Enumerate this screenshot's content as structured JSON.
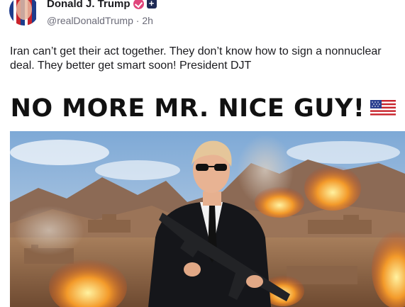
{
  "post": {
    "display_name": "Donald J. Trump",
    "handle": "@realDonaldTrump",
    "separator": "·",
    "timestamp": "2h",
    "text": "Iran can’t get their act together. They don’t know how to sign a nonnuclear deal. They better get smart soon! President DJT",
    "follow_symbol": "+"
  },
  "media": {
    "headline": "NO MORE MR. NICE GUY!",
    "flag_icon": "us-flag-icon"
  },
  "colors": {
    "verified": "#e0457b",
    "follow": "#1e2a55",
    "text_muted": "#6b6b78"
  }
}
